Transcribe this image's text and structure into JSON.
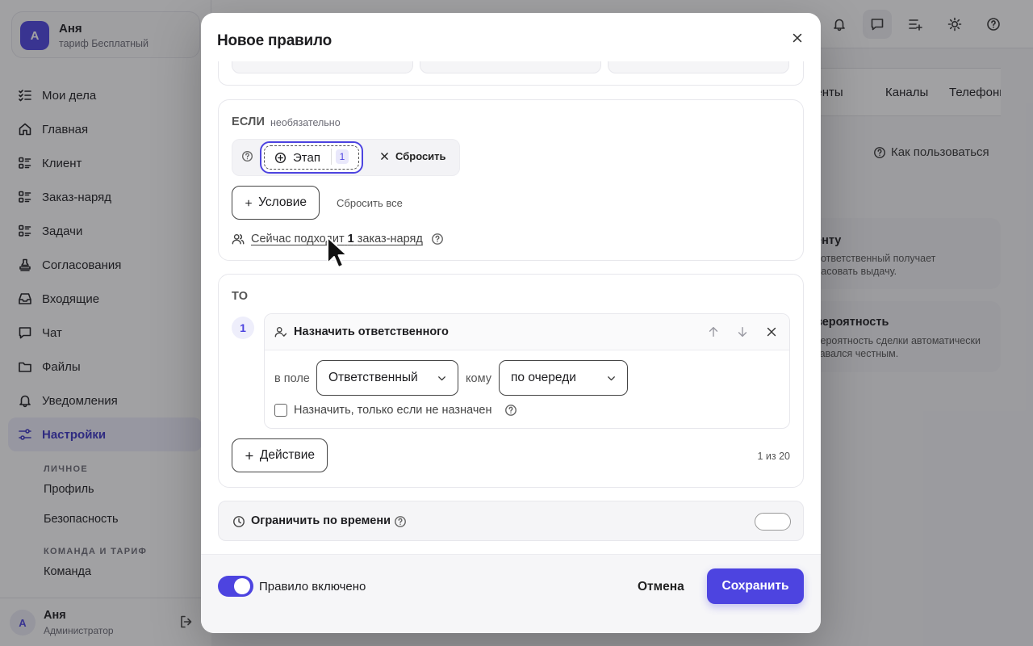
{
  "account": {
    "avatar_letter": "А",
    "name": "Аня",
    "plan": "тариф Бесплатный"
  },
  "sidebar": {
    "items": [
      {
        "label": "Мои дела",
        "icon": "checklist-icon"
      },
      {
        "label": "Главная",
        "icon": "home-icon"
      },
      {
        "label": "Клиент",
        "icon": "list-icon"
      },
      {
        "label": "Заказ-наряд",
        "icon": "list-icon"
      },
      {
        "label": "Задачи",
        "icon": "list-icon"
      },
      {
        "label": "Согласования",
        "icon": "stamp-icon"
      },
      {
        "label": "Входящие",
        "icon": "inbox-icon"
      },
      {
        "label": "Чат",
        "icon": "chat-icon"
      },
      {
        "label": "Файлы",
        "icon": "folder-icon"
      },
      {
        "label": "Уведомления",
        "icon": "bell-icon"
      },
      {
        "label": "Настройки",
        "icon": "sliders-icon",
        "active": true
      }
    ],
    "section_personal": "ЛИЧНОЕ",
    "profile": "Профиль",
    "security": "Безопасность",
    "section_team": "КОМАНДА И ТАРИФ",
    "team": "Команда"
  },
  "user": {
    "avatar_letter": "А",
    "name": "Аня",
    "role": "Администратор"
  },
  "background": {
    "tabs": [
      "кументы",
      "Каналы",
      "Телефони"
    ],
    "help_link": "Как пользоваться",
    "card1": {
      "title": "енту",
      "line1": ", ответственный получает",
      "line2": "ласовать выдачу."
    },
    "card2": {
      "title": "вероятность",
      "line1": "вероятность сделки автоматически",
      "line2": "тавался честным."
    }
  },
  "modal": {
    "title": "Новое правило",
    "if_section": {
      "label": "ЕСЛИ",
      "note": "необязательно",
      "chip_label": "Этап",
      "chip_count": "1",
      "reset_label": "Сбросить",
      "add_condition": "Условие",
      "reset_all": "Сбросить все",
      "match_prefix": "Сейчас подходит",
      "match_count": "1",
      "match_suffix": "заказ-наряд"
    },
    "then_section": {
      "label": "ТО",
      "step": "1",
      "action_title": "Назначить ответственного",
      "field_label": "в поле",
      "field_value": "Ответственный",
      "to_label": "кому",
      "to_value": "по очереди",
      "checkbox_label": "Назначить, только если не назначен",
      "add_action": "Действие",
      "counter": "1 из 20"
    },
    "time_limit": {
      "label": "Ограничить по времени",
      "enabled": false
    },
    "footer": {
      "rule_enabled_label": "Правило включено",
      "enabled": true,
      "cancel": "Отмена",
      "save": "Сохранить"
    }
  },
  "colors": {
    "accent": "#4d44e0",
    "overlay": "rgba(30,30,36,0.42)"
  }
}
